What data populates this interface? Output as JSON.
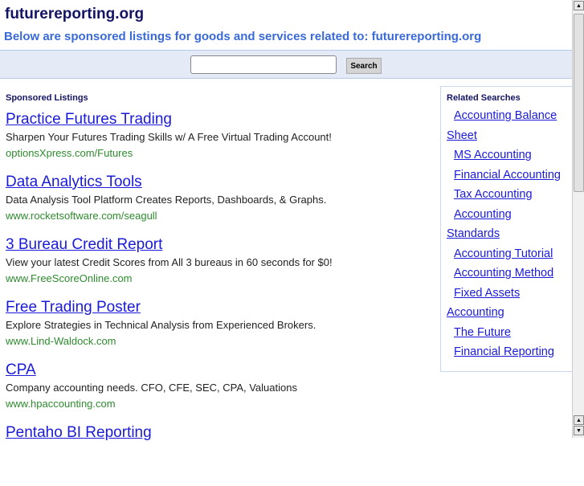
{
  "header": {
    "title": "futurereporting.org",
    "subtitle": "Below are sponsored listings for goods and services related to: futurereporting.org"
  },
  "search": {
    "value": "",
    "button": "Search"
  },
  "sponsored": {
    "heading": "Sponsored Listings",
    "listings": [
      {
        "title": "Practice Futures Trading",
        "desc": "Sharpen Your Futures Trading Skills w/ A Free Virtual Trading Account!",
        "url": "optionsXpress.com/Futures"
      },
      {
        "title": "Data Analytics Tools",
        "desc": "Data Analysis Tool Platform Creates Reports, Dashboards, & Graphs.",
        "url": "www.rocketsoftware.com/seagull"
      },
      {
        "title": "3 Bureau Credit Report",
        "desc": "View your latest Credit Scores from All 3 bureaus in 60 seconds for $0!",
        "url": "www.FreeScoreOnline.com"
      },
      {
        "title": "Free Trading Poster",
        "desc": "Explore Strategies in Technical Analysis from Experienced Brokers.",
        "url": "www.Lind-Waldock.com"
      },
      {
        "title": "CPA",
        "desc": "Company accounting needs. CFO, CFE, SEC, CPA, Valuations",
        "url": "www.hpaccounting.com"
      },
      {
        "title": "Pentaho BI Reporting",
        "desc": "",
        "url": ""
      }
    ]
  },
  "related": {
    "heading": "Related Searches",
    "items": [
      {
        "lines": [
          "Accounting Balance",
          "Sheet"
        ]
      },
      {
        "lines": [
          "MS Accounting"
        ]
      },
      {
        "lines": [
          "Financial Accounting"
        ]
      },
      {
        "lines": [
          "Tax Accounting"
        ]
      },
      {
        "lines": [
          "Accounting",
          "Standards"
        ]
      },
      {
        "lines": [
          "Accounting Tutorial"
        ]
      },
      {
        "lines": [
          "Accounting Method"
        ]
      },
      {
        "lines": [
          "Fixed Assets",
          "Accounting"
        ]
      },
      {
        "lines": [
          "The Future"
        ]
      },
      {
        "lines": [
          "Financial Reporting"
        ]
      }
    ]
  }
}
